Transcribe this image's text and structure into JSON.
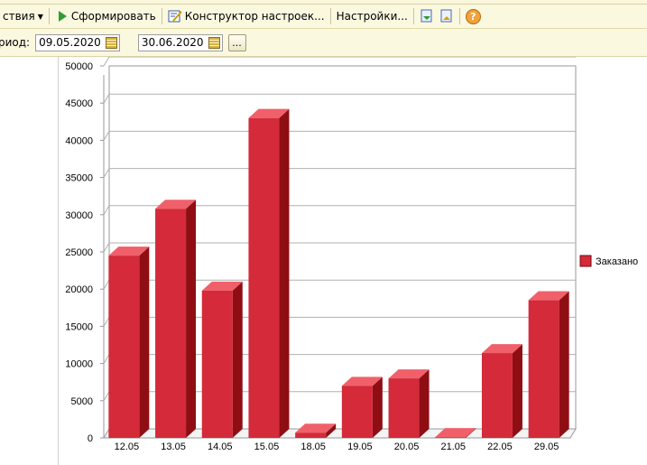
{
  "toolbar": {
    "actions_label": "ствия",
    "generate_label": "Сформировать",
    "constructor_label": "Конструктор настроек...",
    "settings_label": "Настройки...",
    "help_label": "?"
  },
  "period": {
    "label": "риод:",
    "from": "09.05.2020",
    "to": "30.06.2020",
    "more_label": "..."
  },
  "colors": {
    "bar_front": "#d42a3a",
    "bar_top": "#f0606a",
    "bar_side": "#8e0e14"
  },
  "chart_data": {
    "type": "bar",
    "categories": [
      "12.05",
      "13.05",
      "14.05",
      "15.05",
      "18.05",
      "19.05",
      "20.05",
      "21.05",
      "22.05",
      "29.05"
    ],
    "series": [
      {
        "name": "Заказано",
        "values": [
          24500,
          30800,
          19800,
          43000,
          700,
          7000,
          8000,
          100,
          11400,
          18500
        ]
      }
    ],
    "ylim": [
      0,
      50000
    ],
    "yticks": [
      "0",
      "5000",
      "10000",
      "15000",
      "20000",
      "25000",
      "30000",
      "35000",
      "40000",
      "45000",
      "50000"
    ],
    "legend_position": "right",
    "grid": true
  }
}
